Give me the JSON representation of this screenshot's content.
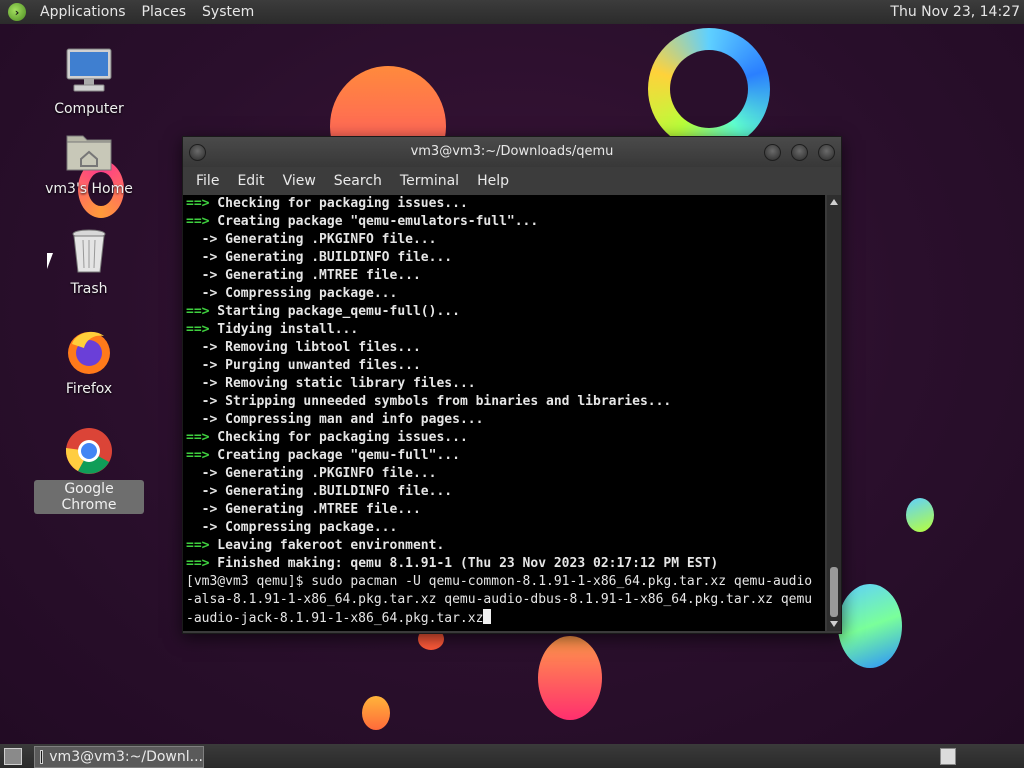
{
  "top_panel": {
    "menus": [
      "Applications",
      "Places",
      "System"
    ],
    "clock": "Thu Nov 23, 14:27"
  },
  "desktop": {
    "icons": [
      {
        "label": "Computer",
        "icon": "computer-icon"
      },
      {
        "label": "vm3's Home",
        "icon": "home-folder-icon"
      },
      {
        "label": "Trash",
        "icon": "trash-icon"
      },
      {
        "label": "Firefox",
        "icon": "firefox-icon"
      },
      {
        "label": "Google Chrome",
        "icon": "chrome-icon",
        "selected": true
      }
    ]
  },
  "terminal": {
    "title": "vm3@vm3:~/Downloads/qemu",
    "menus": [
      "File",
      "Edit",
      "View",
      "Search",
      "Terminal",
      "Help"
    ],
    "lines": [
      {
        "marker": "==>",
        "kind": "g",
        "text": " Checking for packaging issues..."
      },
      {
        "marker": "==>",
        "kind": "g",
        "text": " Creating package \"qemu-emulators-full\"..."
      },
      {
        "marker": "  ->",
        "kind": "b",
        "text": " Generating .PKGINFO file..."
      },
      {
        "marker": "  ->",
        "kind": "b",
        "text": " Generating .BUILDINFO file..."
      },
      {
        "marker": "  ->",
        "kind": "b",
        "text": " Generating .MTREE file..."
      },
      {
        "marker": "  ->",
        "kind": "b",
        "text": " Compressing package..."
      },
      {
        "marker": "==>",
        "kind": "g",
        "text": " Starting package_qemu-full()..."
      },
      {
        "marker": "==>",
        "kind": "g",
        "text": " Tidying install..."
      },
      {
        "marker": "  ->",
        "kind": "b",
        "text": " Removing libtool files..."
      },
      {
        "marker": "  ->",
        "kind": "b",
        "text": " Purging unwanted files..."
      },
      {
        "marker": "  ->",
        "kind": "b",
        "text": " Removing static library files..."
      },
      {
        "marker": "  ->",
        "kind": "b",
        "text": " Stripping unneeded symbols from binaries and libraries..."
      },
      {
        "marker": "  ->",
        "kind": "b",
        "text": " Compressing man and info pages..."
      },
      {
        "marker": "==>",
        "kind": "g",
        "text": " Checking for packaging issues..."
      },
      {
        "marker": "==>",
        "kind": "g",
        "text": " Creating package \"qemu-full\"..."
      },
      {
        "marker": "  ->",
        "kind": "b",
        "text": " Generating .PKGINFO file..."
      },
      {
        "marker": "  ->",
        "kind": "b",
        "text": " Generating .BUILDINFO file..."
      },
      {
        "marker": "  ->",
        "kind": "b",
        "text": " Generating .MTREE file..."
      },
      {
        "marker": "  ->",
        "kind": "b",
        "text": " Compressing package..."
      },
      {
        "marker": "==>",
        "kind": "g",
        "text": " Leaving fakeroot environment."
      },
      {
        "marker": "==>",
        "kind": "g",
        "text": " Finished making: qemu 8.1.91-1 (Thu 23 Nov 2023 02:17:12 PM EST)"
      }
    ],
    "command_lines": [
      "[vm3@vm3 qemu]$ sudo pacman -U qemu-common-8.1.91-1-x86_64.pkg.tar.xz qemu-audio",
      "-alsa-8.1.91-1-x86_64.pkg.tar.xz qemu-audio-dbus-8.1.91-1-x86_64.pkg.tar.xz qemu",
      "-audio-jack-8.1.91-1-x86_64.pkg.tar.xz"
    ]
  },
  "taskbar": {
    "task_label": "vm3@vm3:~/Downl..."
  }
}
